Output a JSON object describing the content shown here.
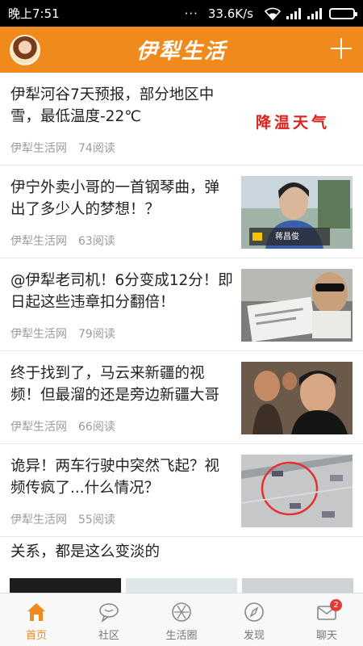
{
  "status_bar": {
    "time": "晚上7:51",
    "dots": "···",
    "speed": "33.6K/s"
  },
  "header": {
    "title": "伊犁生活",
    "avatar_icon": "user-avatar",
    "add_icon": "plus-icon"
  },
  "articles": [
    {
      "title": "伊犁河谷7天预报，部分地区中雪，最低温度-22℃",
      "source": "伊犁生活网",
      "reads": "74阅读",
      "thumb_text": "降温天气"
    },
    {
      "title": "伊宁外卖小哥的一首钢琴曲，弹出了多少人的梦想！？",
      "source": "伊犁生活网",
      "reads": "63阅读",
      "thumb_text": "蒋昌俊"
    },
    {
      "title": "@伊犁老司机！6分变成12分！即日起这些违章扣分翻倍！",
      "source": "伊犁生活网",
      "reads": "79阅读"
    },
    {
      "title": "终于找到了，马云来新疆的视频！但最溜的还是旁边新疆大哥",
      "source": "伊犁生活网",
      "reads": "66阅读"
    },
    {
      "title": "诡异！两车行驶中突然飞起？视频传疯了...什么情况？",
      "source": "伊犁生活网",
      "reads": "55阅读"
    },
    {
      "title": "关系，都是这么变淡的"
    }
  ],
  "bottom_nav": {
    "items": [
      {
        "label": "首页",
        "icon": "home-icon",
        "active": true
      },
      {
        "label": "社区",
        "icon": "chat-bubble-icon"
      },
      {
        "label": "生活圈",
        "icon": "aperture-icon"
      },
      {
        "label": "发现",
        "icon": "compass-icon"
      },
      {
        "label": "聊天",
        "icon": "mail-icon",
        "badge": "2"
      }
    ]
  },
  "colors": {
    "brand": "#f08a1c",
    "badge": "#e53935",
    "thumb_text_red": "#e0201c"
  }
}
